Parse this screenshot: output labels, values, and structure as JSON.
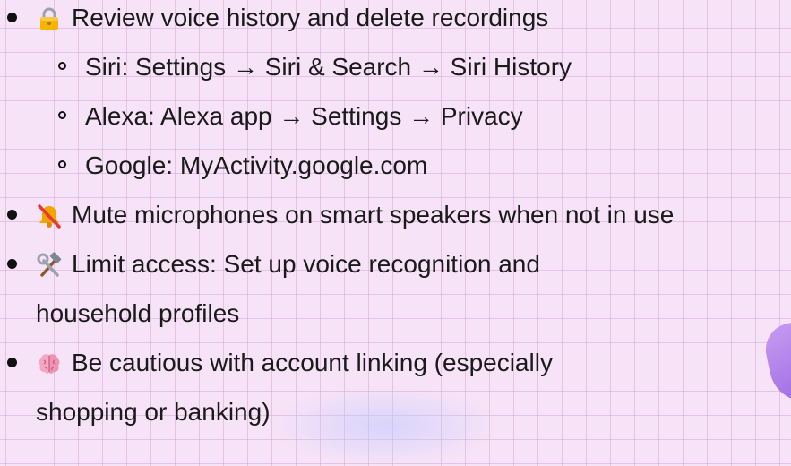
{
  "items": [
    {
      "icon": "lock-icon",
      "text": "Review voice history and delete recordings",
      "subitems": [
        "Siri: Settings → Siri & Search → Siri History",
        "Alexa: Alexa app → Settings → Privacy",
        "Google: MyActivity.google.com"
      ]
    },
    {
      "icon": "muted-bell-icon",
      "text": "Mute microphones on smart speakers when not in use"
    },
    {
      "icon": "hammer-and-wrench-icon",
      "text": "Limit access: Set up voice recognition and",
      "continuation": "household profiles"
    },
    {
      "icon": "brain-icon",
      "text": "Be cautious with account linking (especially",
      "continuation": "shopping or banking)"
    }
  ],
  "colors": {
    "background": "#f7e3f7",
    "grid": "#d6aad6",
    "text": "#1a1a1a",
    "accent": "#9a66e0"
  }
}
